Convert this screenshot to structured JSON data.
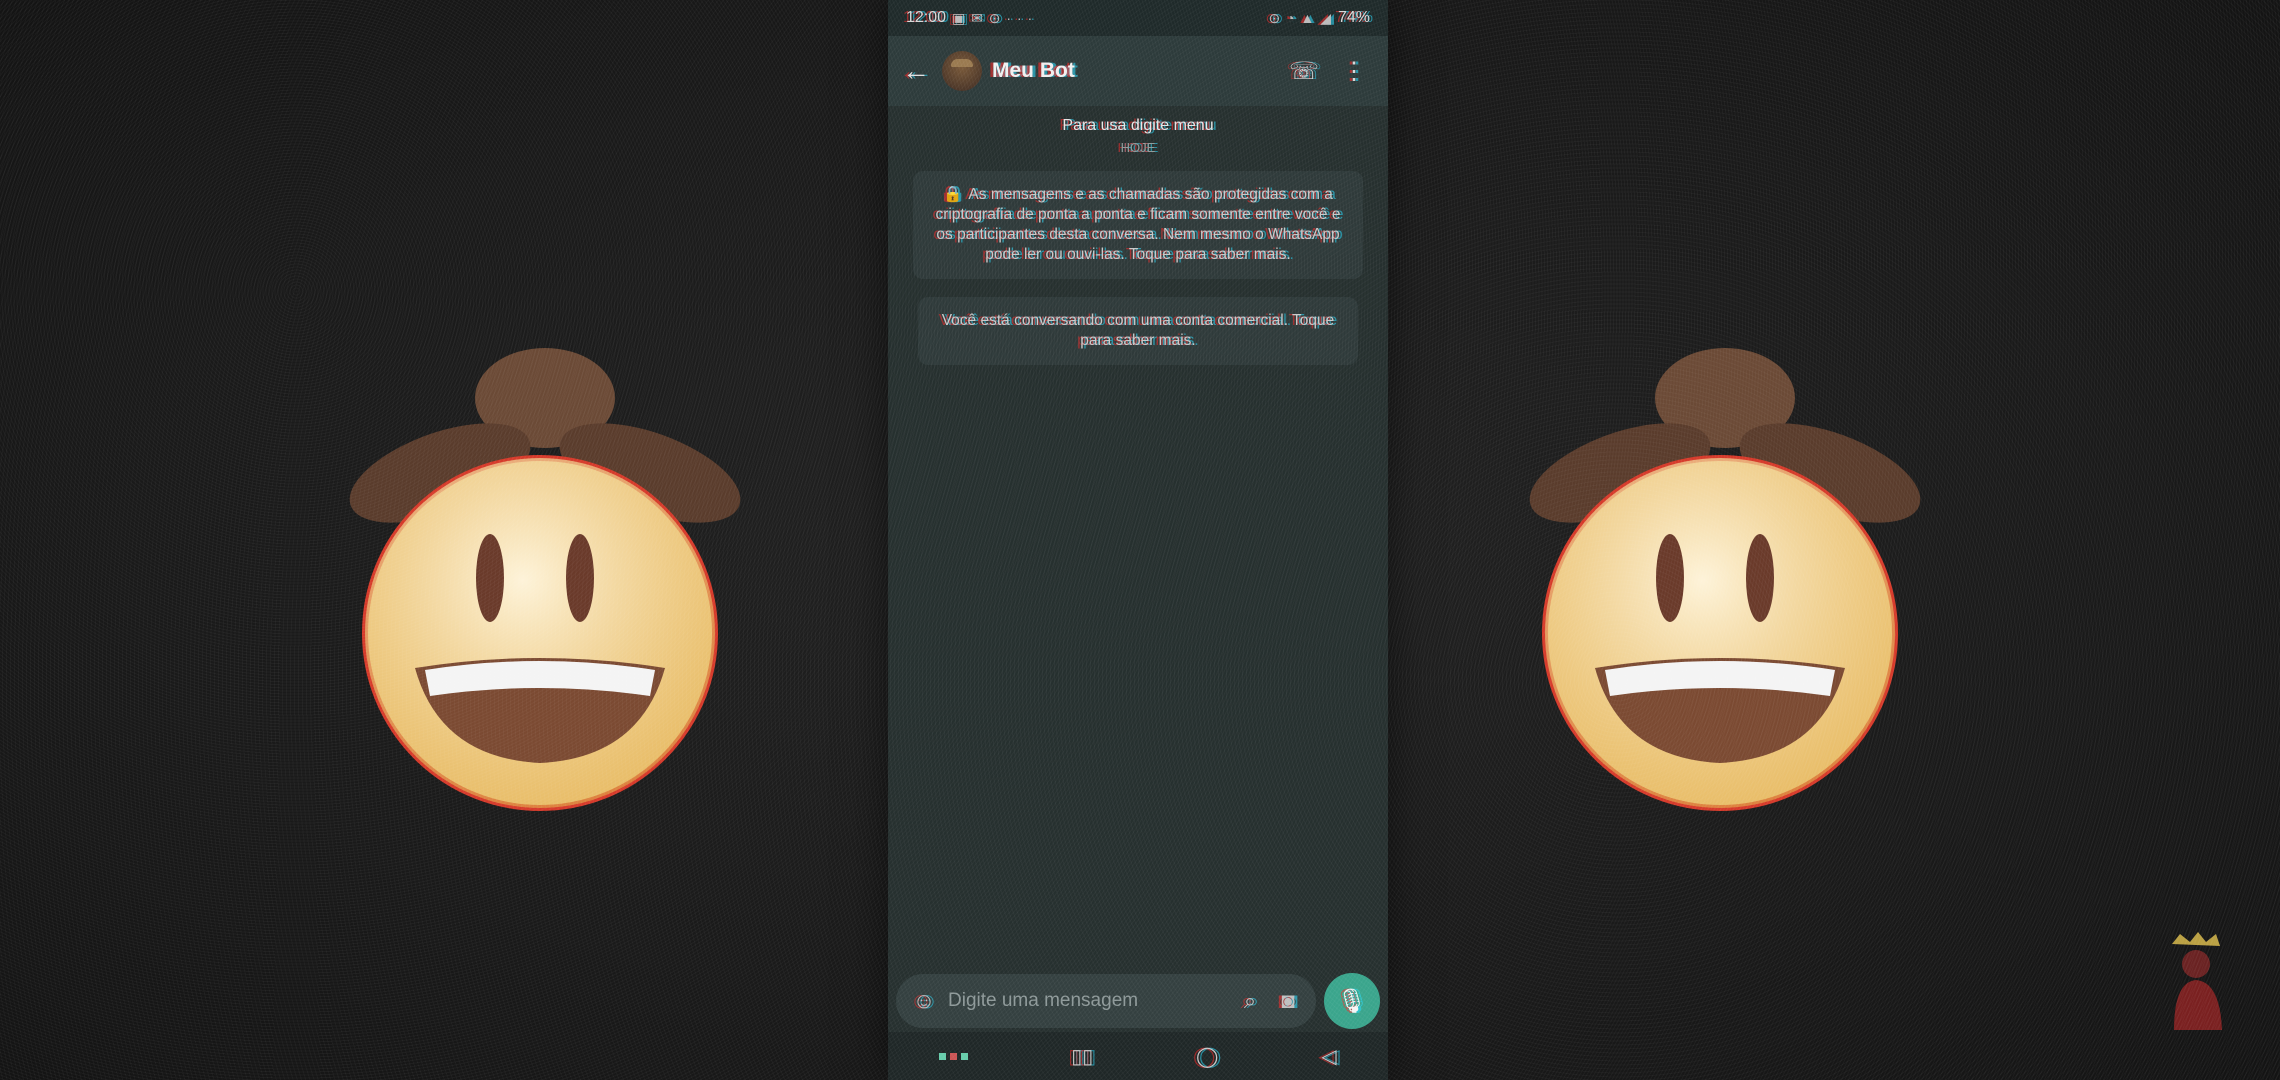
{
  "status_bar": {
    "time": "12:00",
    "battery": "74%"
  },
  "header": {
    "contact_name": "Meu Bot"
  },
  "chat": {
    "hint_chip": "Para usa digite menu",
    "date_chip": "HOJE",
    "encryption_notice": "As mensagens e as chamadas são protegidas com a criptografia de ponta a ponta e ficam somente entre você e os participantes desta conversa. Nem mesmo o WhatsApp pode ler ou ouvi-las. Toque para saber mais.",
    "business_notice": "Você está conversando com uma conta comercial. Toque para saber mais."
  },
  "composer": {
    "placeholder": "Digite uma mensagem"
  },
  "icons": {
    "back": "back-arrow-icon",
    "call": "add-call-icon",
    "menu": "more-vert-icon",
    "emoji": "emoji-icon",
    "attach": "paperclip-icon",
    "camera": "camera-icon",
    "mic": "mic-icon"
  },
  "colors": {
    "accent": "#3aa58c",
    "chat_bg": "#26302f",
    "header_bg": "#2d3b3b"
  }
}
